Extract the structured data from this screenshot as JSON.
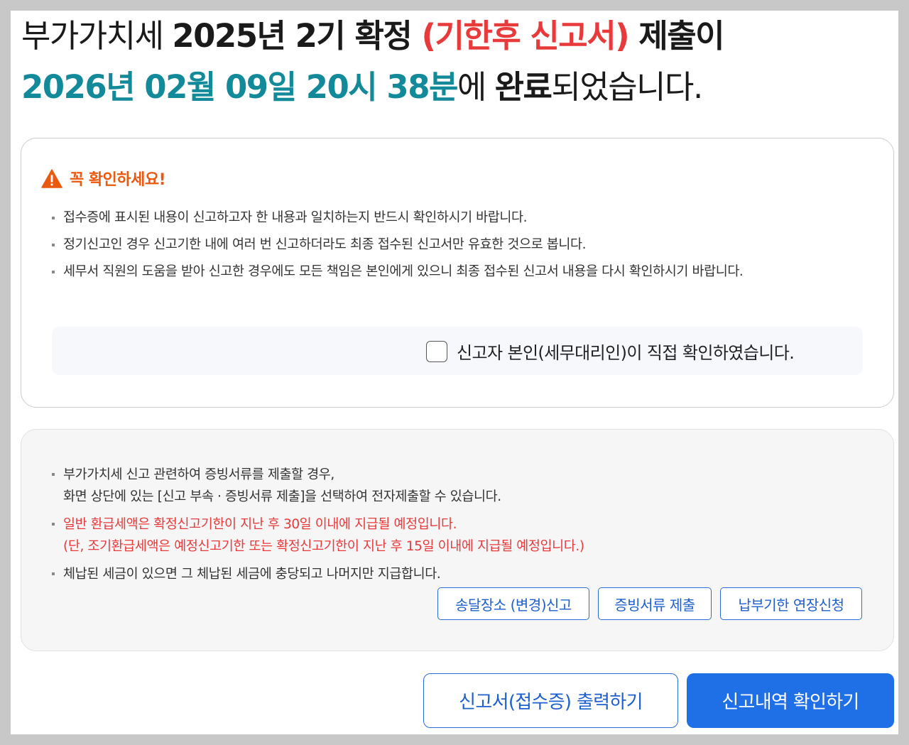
{
  "headline": {
    "line1_plain": "부가가치세 ",
    "line1_bold": "2025년 2기 확정 ",
    "line1_red": "(기한후 신고서)",
    "line1_end": " 제출이",
    "line2_teal": "2026년 02월 09일 20시 38분",
    "line2_mid": "에 ",
    "line2_bold": "완료",
    "line2_end": "되었습니다."
  },
  "notice": {
    "title": "꼭 확인하세요!",
    "icon": "warning-triangle-icon",
    "items": [
      "접수증에 표시된 내용이 신고하고자 한 내용과 일치하는지 반드시 확인하시기 바랍니다.",
      "정기신고인 경우 신고기한 내에 여러 번 신고하더라도 최종 접수된 신고서만 유효한 것으로 봅니다.",
      "세무서 직원의 도움을 받아 신고한 경우에도 모든 책임은 본인에게 있으니 최종 접수된 신고서 내용을 다시 확인하시기 바랍니다."
    ],
    "checkbox_label": "신고자 본인(세무대리인)이 직접 확인하였습니다.",
    "checkbox_checked": false
  },
  "info": {
    "item1_line1": "부가가치세 신고 관련하여 증빙서류를 제출할 경우,",
    "item1_line2": "화면 상단에 있는 [신고 부속 · 증빙서류 제출]을 선택하여 전자제출할 수 있습니다.",
    "item2_line1": "일반 환급세액은 확정신고기한이 지난 후 30일 이내에 지급될 예정입니다.",
    "item2_line2": "(단, 조기환급세액은 예정신고기한 또는 확정신고기한이 지난 후 15일 이내에 지급될 예정입니다.)",
    "item3": "체납된 세금이 있으면 그 체납된 세금에 충당되고 나머지만 지급합니다.",
    "buttons": {
      "address_change": "송달장소 (변경)신고",
      "evidence_submit": "증빙서류 제출",
      "deadline_extension": "납부기한 연장신청"
    }
  },
  "actions": {
    "print_label": "신고서(접수증) 출력하기",
    "confirm_label": "신고내역 확인하기"
  },
  "colors": {
    "accent_red": "#e83a3a",
    "accent_teal": "#138a9a",
    "warning_orange": "#e9590f",
    "primary_blue": "#1f6fe6"
  }
}
